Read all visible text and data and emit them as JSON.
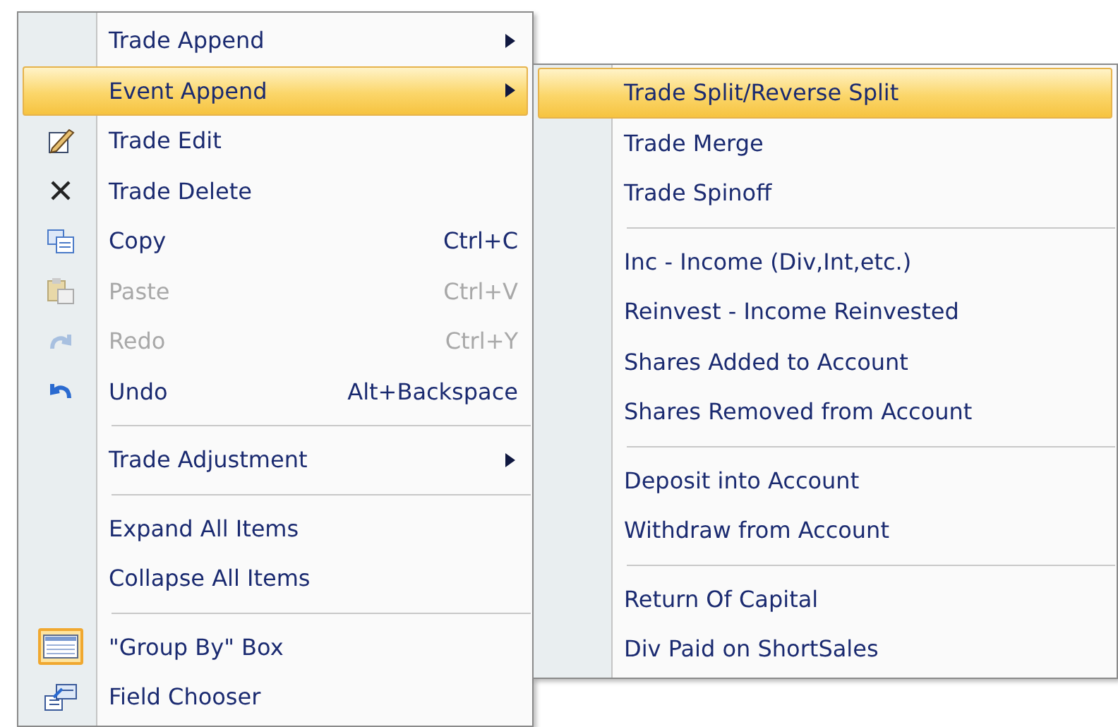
{
  "main_menu": {
    "items": [
      {
        "kind": "item",
        "label": "Trade Append",
        "submenu": true,
        "selected": false,
        "disabled": false,
        "checked": false
      },
      {
        "kind": "item",
        "label": "Event Append",
        "submenu": true,
        "selected": true,
        "disabled": false,
        "checked": false
      },
      {
        "kind": "item",
        "label": "Trade Edit",
        "submenu": false,
        "selected": false,
        "disabled": false,
        "checked": false
      },
      {
        "kind": "item",
        "label": "Trade Delete",
        "submenu": false,
        "selected": false,
        "disabled": false,
        "checked": false
      },
      {
        "kind": "item",
        "label": "Copy",
        "shortcut": "Ctrl+C",
        "submenu": false,
        "selected": false,
        "disabled": false,
        "checked": false
      },
      {
        "kind": "item",
        "label": "Paste",
        "shortcut": "Ctrl+V",
        "submenu": false,
        "selected": false,
        "disabled": true,
        "checked": false
      },
      {
        "kind": "item",
        "label": "Redo",
        "shortcut": "Ctrl+Y",
        "submenu": false,
        "selected": false,
        "disabled": true,
        "checked": false
      },
      {
        "kind": "item",
        "label": "Undo",
        "shortcut": "Alt+Backspace",
        "submenu": false,
        "selected": false,
        "disabled": false,
        "checked": false
      },
      {
        "kind": "separator"
      },
      {
        "kind": "item",
        "label": "Trade Adjustment",
        "submenu": true,
        "selected": false,
        "disabled": false,
        "checked": false
      },
      {
        "kind": "separator"
      },
      {
        "kind": "item",
        "label": "Expand All Items",
        "submenu": false,
        "selected": false,
        "disabled": false,
        "checked": false
      },
      {
        "kind": "item",
        "label": "Collapse All Items",
        "submenu": false,
        "selected": false,
        "disabled": false,
        "checked": false
      },
      {
        "kind": "separator"
      },
      {
        "kind": "item",
        "label": "\"Group By\" Box",
        "submenu": false,
        "selected": false,
        "disabled": false,
        "checked": true
      },
      {
        "kind": "item",
        "label": "Field Chooser",
        "submenu": false,
        "selected": false,
        "disabled": false,
        "checked": false
      }
    ]
  },
  "submenu": {
    "items": [
      {
        "kind": "item",
        "label": "Trade Split/Reverse Split",
        "selected": true
      },
      {
        "kind": "item",
        "label": "Trade Merge",
        "selected": false
      },
      {
        "kind": "item",
        "label": "Trade Spinoff",
        "selected": false
      },
      {
        "kind": "separator"
      },
      {
        "kind": "item",
        "label": "Inc - Income (Div,Int,etc.)",
        "selected": false
      },
      {
        "kind": "item",
        "label": "Reinvest - Income Reinvested",
        "selected": false
      },
      {
        "kind": "item",
        "label": "Shares Added to Account",
        "selected": false
      },
      {
        "kind": "item",
        "label": "Shares Removed from Account",
        "selected": false
      },
      {
        "kind": "separator"
      },
      {
        "kind": "item",
        "label": "Deposit into Account",
        "selected": false
      },
      {
        "kind": "item",
        "label": "Withdraw from Account",
        "selected": false
      },
      {
        "kind": "separator"
      },
      {
        "kind": "item",
        "label": "Return Of Capital",
        "selected": false
      },
      {
        "kind": "item",
        "label": "Div Paid on ShortSales",
        "selected": false
      }
    ]
  }
}
